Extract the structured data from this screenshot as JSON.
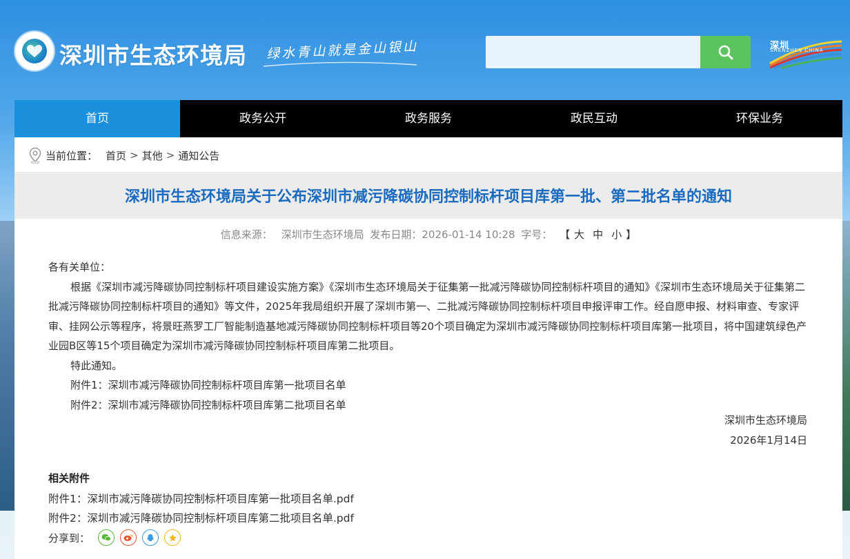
{
  "header": {
    "site_title": "深圳市生态环境局",
    "slogan": "绿水青山就是金山银山",
    "search": {
      "placeholder": "",
      "value": ""
    },
    "shenzhen_logo": {
      "text_cn": "深圳",
      "text_en": "SHENZHEN CHINA"
    }
  },
  "nav": {
    "items": [
      {
        "label": "首页",
        "active": true
      },
      {
        "label": "政务公开"
      },
      {
        "label": "政务服务"
      },
      {
        "label": "政民互动"
      },
      {
        "label": "环保业务"
      }
    ]
  },
  "breadcrumb": {
    "prefix": "当前位置：",
    "items": [
      "首页",
      "其他",
      "通知公告"
    ],
    "separator": ">"
  },
  "article": {
    "title": "深圳市生态环境局关于公布深圳市减污降碳协同控制标杆项目库第一批、第二批名单的通知",
    "meta": {
      "source_label": "信息来源：",
      "source": "深圳市生态环境局",
      "date_label": "发布日期：",
      "date": "2026-01-14 10:28",
      "fontsize_label": "字号：",
      "bracket_open": "【",
      "bracket_close": "】",
      "sizes": [
        "大",
        "中",
        "小"
      ]
    },
    "salutation": "各有关单位：",
    "paragraph": "根据《深圳市减污降碳协同控制标杆项目建设实施方案》《深圳市生态环境局关于征集第一批减污降碳协同控制标杆项目的通知》《深圳市生态环境局关于征集第二批减污降碳协同控制标杆项目的通知》等文件，2025年我局组织开展了深圳市第一、二批减污降碳协同控制标杆项目申报评审工作。经自愿申报、材料审查、专家评审、挂网公示等程序，将景旺燕罗工厂智能制造基地减污降碳协同控制标杆项目等20个项目确定为深圳市减污降碳协同控制标杆项目库第一批项目，将中国建筑绿色产业园B区等15个项目确定为深圳市减污降碳协同控制标杆项目库第二批项目。",
    "notice": "特此通知。",
    "attachments_inline": [
      "附件1：深圳市减污降碳协同控制标杆项目库第一批项目名单",
      "附件2：深圳市减污降碳协同控制标杆项目库第二批项目名单"
    ],
    "signature": "深圳市生态环境局",
    "sign_date": "2026年1月14日"
  },
  "related": {
    "title": "相关附件",
    "files": [
      "附件1：深圳市减污降碳协同控制标杆项目库第一批项目名单.pdf",
      "附件2：深圳市减污降碳协同控制标杆项目库第二批项目名单.pdf"
    ]
  },
  "share": {
    "label": "分享到：",
    "icons": [
      {
        "name": "wechat-icon",
        "color": "#55b837"
      },
      {
        "name": "weibo-icon",
        "color": "#e6572f"
      },
      {
        "name": "qq-icon",
        "color": "#3a9ce0"
      },
      {
        "name": "qzone-icon",
        "color": "#f3b51b"
      }
    ]
  },
  "colors": {
    "accent": "#1a8fdb",
    "title": "#1a6bbf",
    "search_button": "#5cc45e",
    "nav_bg": "#000000"
  }
}
